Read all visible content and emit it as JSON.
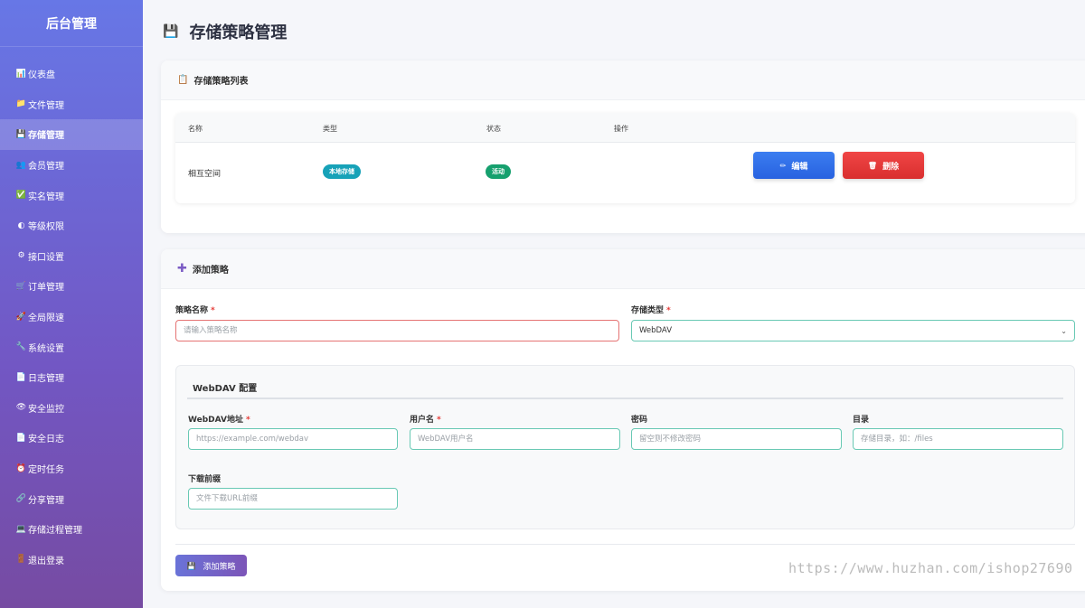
{
  "sidebar": {
    "title": "后台管理",
    "items": [
      {
        "icon": "📊",
        "label": "仪表盘"
      },
      {
        "icon": "📁",
        "label": "文件管理"
      },
      {
        "icon": "💾",
        "label": "存储管理"
      },
      {
        "icon": "👥",
        "label": "会员管理"
      },
      {
        "icon": "✅",
        "label": "实名管理"
      },
      {
        "icon": "◐",
        "label": "等级权限"
      },
      {
        "icon": "⚙",
        "label": "接口设置"
      },
      {
        "icon": "🛒",
        "label": "订单管理"
      },
      {
        "icon": "🚀",
        "label": "全局限速"
      },
      {
        "icon": "🔧",
        "label": "系统设置"
      },
      {
        "icon": "📄",
        "label": "日志管理"
      },
      {
        "icon": "👁",
        "label": "安全监控"
      },
      {
        "icon": "📄",
        "label": "安全日志"
      },
      {
        "icon": "⏰",
        "label": "定时任务"
      },
      {
        "icon": "🔗",
        "label": "分享管理"
      },
      {
        "icon": "💻",
        "label": "存储过程管理"
      },
      {
        "icon": "🚪",
        "label": "退出登录"
      }
    ],
    "active_index": 2
  },
  "page": {
    "icon": "💾",
    "title": "存储策略管理"
  },
  "list_card": {
    "icon": "📋",
    "title": "存储策略列表",
    "columns": [
      "名称",
      "类型",
      "状态",
      "操作"
    ],
    "rows": [
      {
        "name": "相互空间",
        "type": "本地存储",
        "status": "活动",
        "edit_label": "编辑",
        "delete_label": "删除"
      }
    ],
    "colors": {
      "type_badge": "#17a2b8",
      "status_badge": "#16a06e",
      "edit": "#2f6fea",
      "delete": "#e53935"
    }
  },
  "add_card": {
    "icon": "✚",
    "title": "添加策略",
    "name_label": "策略名称",
    "name_placeholder": "请输入策略名称",
    "type_label": "存储类型",
    "type_value": "WebDAV",
    "required_mark": "*",
    "webdav": {
      "title": "WebDAV 配置",
      "url_label": "WebDAV地址",
      "url_placeholder": "https://example.com/webdav",
      "user_label": "用户名",
      "user_placeholder": "WebDAV用户名",
      "pass_label": "密码",
      "pass_placeholder": "留空则不修改密码",
      "dir_label": "目录",
      "dir_placeholder": "存储目录，如：/files",
      "prefix_label": "下载前缀",
      "prefix_placeholder": "文件下载URL前缀"
    },
    "submit_icon": "💾",
    "submit_label": "添加策略"
  },
  "watermark": "https://www.huzhan.com/ishop27690"
}
